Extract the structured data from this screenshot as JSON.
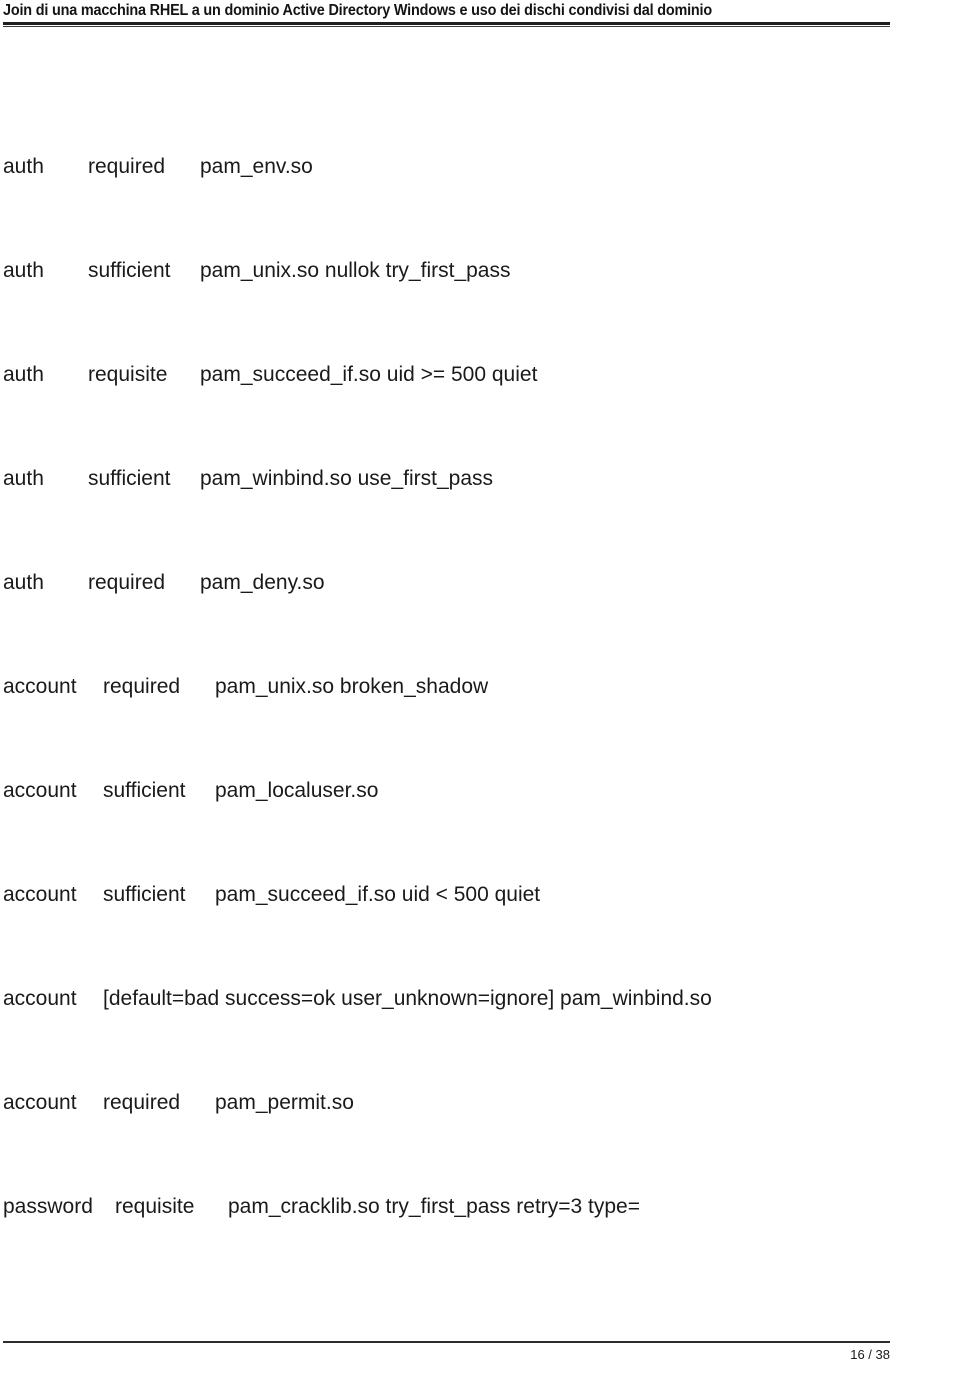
{
  "header": {
    "title": "Join di una macchina RHEL a un dominio Active Directory Windows e uso dei dischi condivisi dal dominio"
  },
  "footer": {
    "page_indicator": "16 / 38"
  },
  "content": {
    "lines": [
      {
        "type": "auth",
        "control": "required",
        "module": "pam_env.so"
      },
      {
        "type": "auth",
        "control": "sufficient",
        "module": "pam_unix.so nullok  try_first_pass"
      },
      {
        "type": "auth",
        "control": "requisite",
        "module": "pam_succeed_if.so uid  >= 500 quiet"
      },
      {
        "type": "auth",
        "control": "sufficient",
        "module": "pam_winbind.so  use_first_pass"
      },
      {
        "type": "auth",
        "control": "required",
        "module": "pam_deny.so"
      },
      {
        "type": "account",
        "control": "required",
        "module": "pam_unix.so  broken_shadow"
      },
      {
        "type": "account",
        "control": "sufficient",
        "module": "pam_localuser.so"
      },
      {
        "type": "account",
        "control": "sufficient",
        "module": "pam_succeed_if.so uid <  500 quiet"
      },
      {
        "type": "account",
        "control": "[default=bad success=ok  user_unknown=ignore] pam_winbind.so",
        "module": ""
      },
      {
        "type": "account",
        "control": "required",
        "module": "pam_permit.so"
      },
      {
        "type": "password",
        "control": "requisite",
        "module": "pam_cracklib.so  try_first_pass retry=3 type="
      }
    ]
  }
}
